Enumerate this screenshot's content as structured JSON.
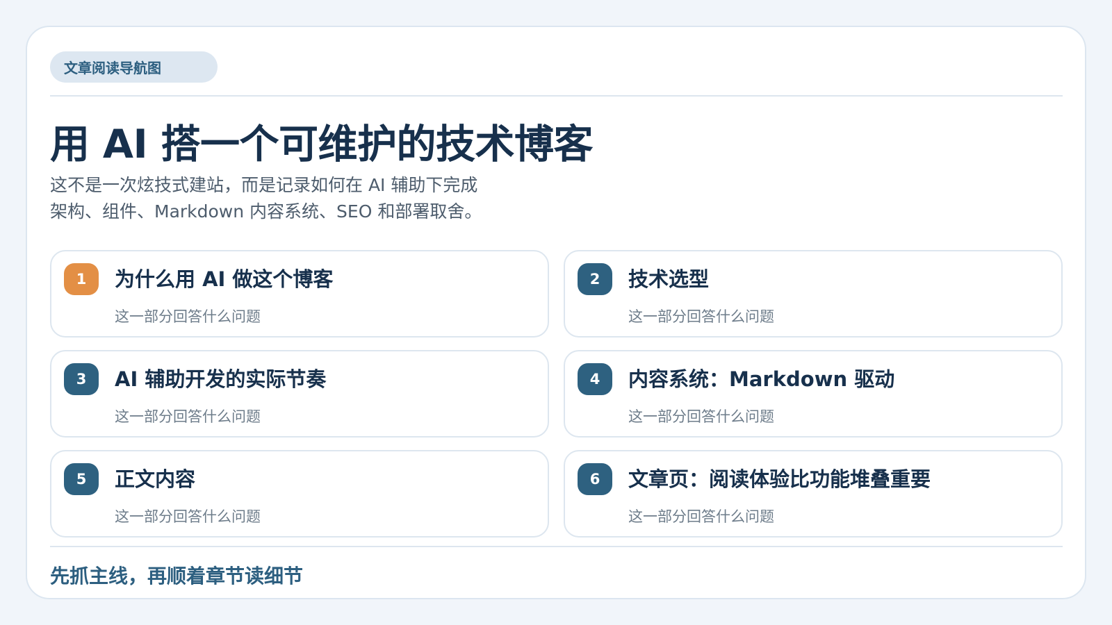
{
  "nav_tag": "文章阅读导航图",
  "title": "用 AI 搭一个可维护的技术博客",
  "intro": "这不是一次炫技式建站，而是记录如何在 AI 辅助下完成架构、组件、Markdown 内容系统、SEO 和部署取舍。",
  "sections": [
    {
      "number": "1",
      "title": "为什么用 AI 做这个博客",
      "description": "这一部分回答什么问题"
    },
    {
      "number": "2",
      "title": "技术选型",
      "description": "这一部分回答什么问题"
    },
    {
      "number": "3",
      "title": "AI 辅助开发的实际节奏",
      "description": "这一部分回答什么问题"
    },
    {
      "number": "4",
      "title": "内容系统：Markdown 驱动",
      "description": "这一部分回答什么问题"
    },
    {
      "number": "5",
      "title": "正文内容",
      "description": "这一部分回答什么问题"
    },
    {
      "number": "6",
      "title": "文章页：阅读体验比功能堆叠重要",
      "description": "这一部分回答什么问题"
    }
  ],
  "footer": "先抓主线，再顺着章节读细节",
  "colors": {
    "accent": "#e38f45",
    "primary": "#2e6180",
    "title": "#17304c",
    "tag_background": "#dde7f1"
  }
}
